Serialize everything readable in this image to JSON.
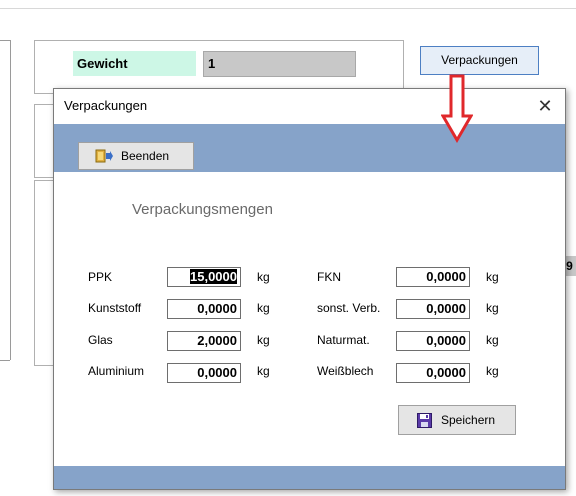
{
  "background": {
    "gewicht_label": "Gewicht",
    "gewicht_value": "1",
    "verpackungen_button": "Verpackungen",
    "partial_value": "9"
  },
  "dialog": {
    "title": "Verpackungen",
    "close_glyph": "✕",
    "beenden_label": "Beenden",
    "section_title": "Verpackungsmengen",
    "unit": "kg",
    "left_fields": [
      {
        "label": "PPK",
        "value": "15,0000",
        "selected": true
      },
      {
        "label": "Kunststoff",
        "value": "0,0000"
      },
      {
        "label": "Glas",
        "value": "2,0000"
      },
      {
        "label": "Aluminium",
        "value": "0,0000"
      }
    ],
    "right_fields": [
      {
        "label": "FKN",
        "value": "0,0000"
      },
      {
        "label": "sonst. Verb.",
        "value": "0,0000"
      },
      {
        "label": "Naturmat.",
        "value": "0,0000"
      },
      {
        "label": "Weißblech",
        "value": "0,0000"
      }
    ],
    "speichern_label": "Speichern"
  },
  "colors": {
    "toolbar_blue": "#86a3c9",
    "gewicht_bg": "#cdf7e6",
    "arrow_red": "#e0282b",
    "button_border_blue": "#4d7fc3"
  },
  "icons": {
    "beenden": "exit-door-icon",
    "speichern": "save-floppy-icon",
    "close": "close-icon",
    "annotation": "red-down-arrow-icon"
  }
}
